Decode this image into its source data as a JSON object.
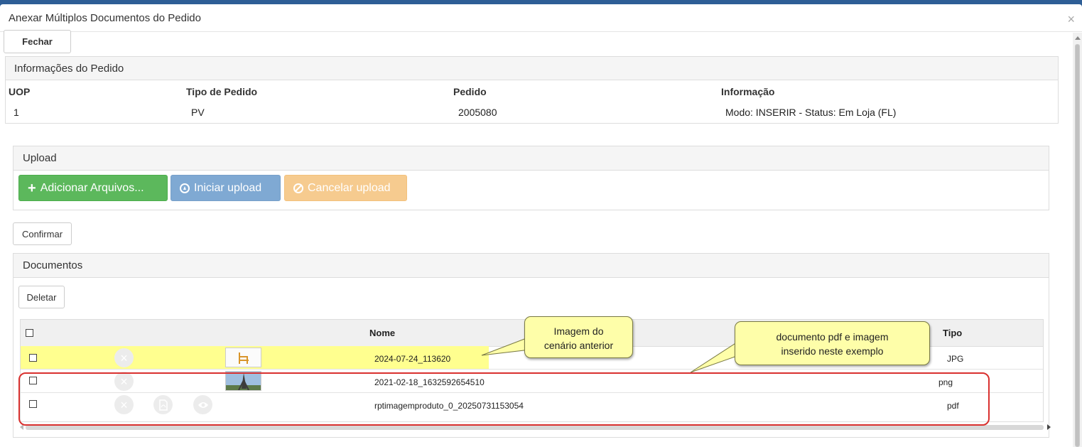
{
  "modal": {
    "title": "Anexar Múltiplos Documentos do Pedido",
    "close_glyph": "×",
    "close_label": "Fechar"
  },
  "info": {
    "title": "Informações do Pedido",
    "headers": [
      "UOP",
      "Tipo de Pedido",
      "Pedido",
      "Informação"
    ],
    "values": [
      "1",
      "PV",
      "2005080",
      "Modo: INSERIR - Status: Em Loja (FL)"
    ]
  },
  "upload": {
    "title": "Upload",
    "add_label": "Adicionar Arquivos...",
    "start_label": "Iniciar upload",
    "cancel_label": "Cancelar upload"
  },
  "confirm_label": "Confirmar",
  "documents": {
    "title": "Documentos",
    "delete_label": "Deletar",
    "columns": {
      "nome": "Nome",
      "tipo": "Tipo"
    },
    "rows": [
      {
        "nome": "2024-07-24_113620",
        "tipo": "JPG",
        "highlight": true,
        "thumb": "chair-thumbnail"
      },
      {
        "nome": "2021-02-18_1632592654510",
        "tipo": "png",
        "highlight": false,
        "thumb": "eiffel-tower-thumbnail"
      },
      {
        "nome": "rptimagemproduto_0_20250731153054",
        "tipo": "pdf",
        "highlight": false,
        "thumb": ""
      }
    ]
  },
  "annotations": {
    "callout_1": [
      "Imagem do",
      "cenário anterior"
    ],
    "callout_2": [
      "documento pdf e imagem",
      "inserido neste exemplo"
    ]
  },
  "colors": {
    "success": "#5cb85c",
    "primary_disabled": "#7fa9d3",
    "warning_disabled": "#f6cb8f",
    "highlight": "#ffff8f",
    "callout_bg": "#fefea9",
    "annotation_border": "#d9312f"
  },
  "icons": {
    "add": "plus-icon",
    "start": "upload-circle-icon",
    "cancel": "ban-icon",
    "remove": "x-circle-icon",
    "pdf": "pdf-file-icon",
    "view": "eye-icon"
  }
}
